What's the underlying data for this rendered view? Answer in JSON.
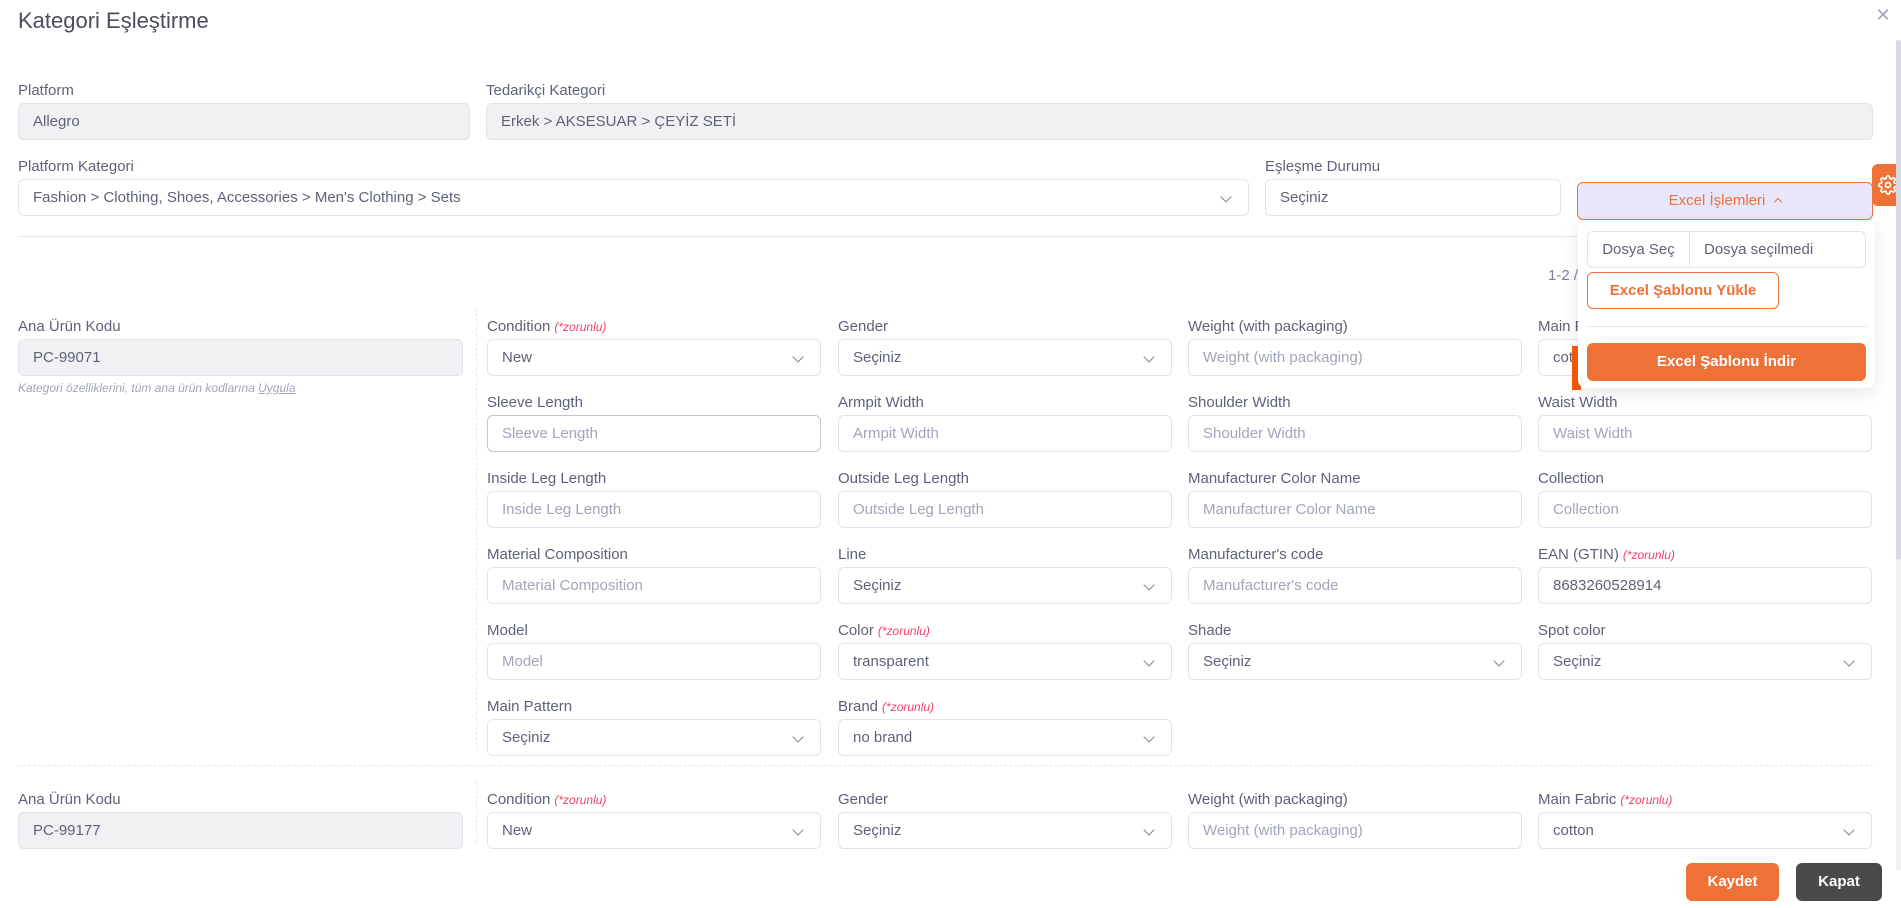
{
  "modal": {
    "title": "Kategori Eşleştirme",
    "close_icon": "close-icon"
  },
  "filters": {
    "platform": {
      "label": "Platform",
      "value": "Allegro"
    },
    "supplier_category": {
      "label": "Tedarikçi Kategori",
      "value": "Erkek > AKSESUAR > ÇEYİZ SETİ"
    },
    "platform_category": {
      "label": "Platform Kategori",
      "value": "Fashion > Clothing, Shoes, Accessories > Men's Clothing > Sets"
    },
    "match_status": {
      "label": "Eşleşme Durumu",
      "value": "Seçiniz"
    }
  },
  "excel": {
    "button_label": "Excel İşlemleri",
    "choose_file": "Dosya Seç",
    "no_file": "Dosya seçilmedi",
    "upload_label": "Excel Şablonu Yükle",
    "download_label": "Excel Şablonu İndir"
  },
  "pagination": {
    "text": "1-2 /"
  },
  "required_tag": "(*zorunlu)",
  "products": [
    {
      "code_label": "Ana Ürün Kodu",
      "code": "PC-99071",
      "hint_text": "Kategori özelliklerini, tüm ana ürün kodlarına",
      "hint_link": "Uygula",
      "attributes": [
        {
          "label": "Condition",
          "required": true,
          "type": "select",
          "value": "New"
        },
        {
          "label": "Gender",
          "required": false,
          "type": "select",
          "value": "Seçiniz"
        },
        {
          "label": "Weight (with packaging)",
          "required": false,
          "type": "input",
          "placeholder": "Weight (with packaging)"
        },
        {
          "label": "Main Fabric",
          "required": true,
          "type": "select",
          "value": "cotton"
        },
        {
          "label": "Sleeve Length",
          "required": false,
          "type": "input",
          "placeholder": "Sleeve Length"
        },
        {
          "label": "Armpit Width",
          "required": false,
          "type": "input",
          "placeholder": "Armpit Width"
        },
        {
          "label": "Shoulder Width",
          "required": false,
          "type": "input",
          "placeholder": "Shoulder Width"
        },
        {
          "label": "Waist Width",
          "required": false,
          "type": "input",
          "placeholder": "Waist Width"
        },
        {
          "label": "Inside Leg Length",
          "required": false,
          "type": "input",
          "placeholder": "Inside Leg Length"
        },
        {
          "label": "Outside Leg Length",
          "required": false,
          "type": "input",
          "placeholder": "Outside Leg Length"
        },
        {
          "label": "Manufacturer Color Name",
          "required": false,
          "type": "input",
          "placeholder": "Manufacturer Color Name"
        },
        {
          "label": "Collection",
          "required": false,
          "type": "input",
          "placeholder": "Collection"
        },
        {
          "label": "Material Composition",
          "required": false,
          "type": "input",
          "placeholder": "Material Composition"
        },
        {
          "label": "Line",
          "required": false,
          "type": "select",
          "value": "Seçiniz"
        },
        {
          "label": "Manufacturer's code",
          "required": false,
          "type": "input",
          "placeholder": "Manufacturer's code"
        },
        {
          "label": "EAN (GTIN)",
          "required": true,
          "type": "input",
          "value": "8683260528914"
        },
        {
          "label": "Model",
          "required": false,
          "type": "input",
          "placeholder": "Model"
        },
        {
          "label": "Color",
          "required": true,
          "type": "select",
          "value": "transparent"
        },
        {
          "label": "Shade",
          "required": false,
          "type": "select",
          "value": "Seçiniz"
        },
        {
          "label": "Spot color",
          "required": false,
          "type": "select",
          "value": "Seçiniz"
        },
        {
          "label": "Main Pattern",
          "required": false,
          "type": "select",
          "value": "Seçiniz"
        },
        {
          "label": "Brand",
          "required": true,
          "type": "select",
          "value": "no brand"
        }
      ]
    },
    {
      "code_label": "Ana Ürün Kodu",
      "code": "PC-99177",
      "hint_text": "Kategori özelliklerini, tüm ana ürün kodlarına",
      "hint_link": "Uygula",
      "attributes": [
        {
          "label": "Condition",
          "required": true,
          "type": "select",
          "value": "New"
        },
        {
          "label": "Gender",
          "required": false,
          "type": "select",
          "value": "Seçiniz"
        },
        {
          "label": "Weight (with packaging)",
          "required": false,
          "type": "input",
          "placeholder": "Weight (with packaging)"
        },
        {
          "label": "Main Fabric",
          "required": true,
          "type": "select",
          "value": "cotton"
        }
      ]
    }
  ],
  "footer": {
    "save_label": "Kaydet",
    "close_label": "Kapat"
  },
  "colors": {
    "accent": "#ee7138",
    "required": "#f1416c",
    "dark_button": "#4a4a4a",
    "readonly_bg": "#f1f1f4"
  }
}
